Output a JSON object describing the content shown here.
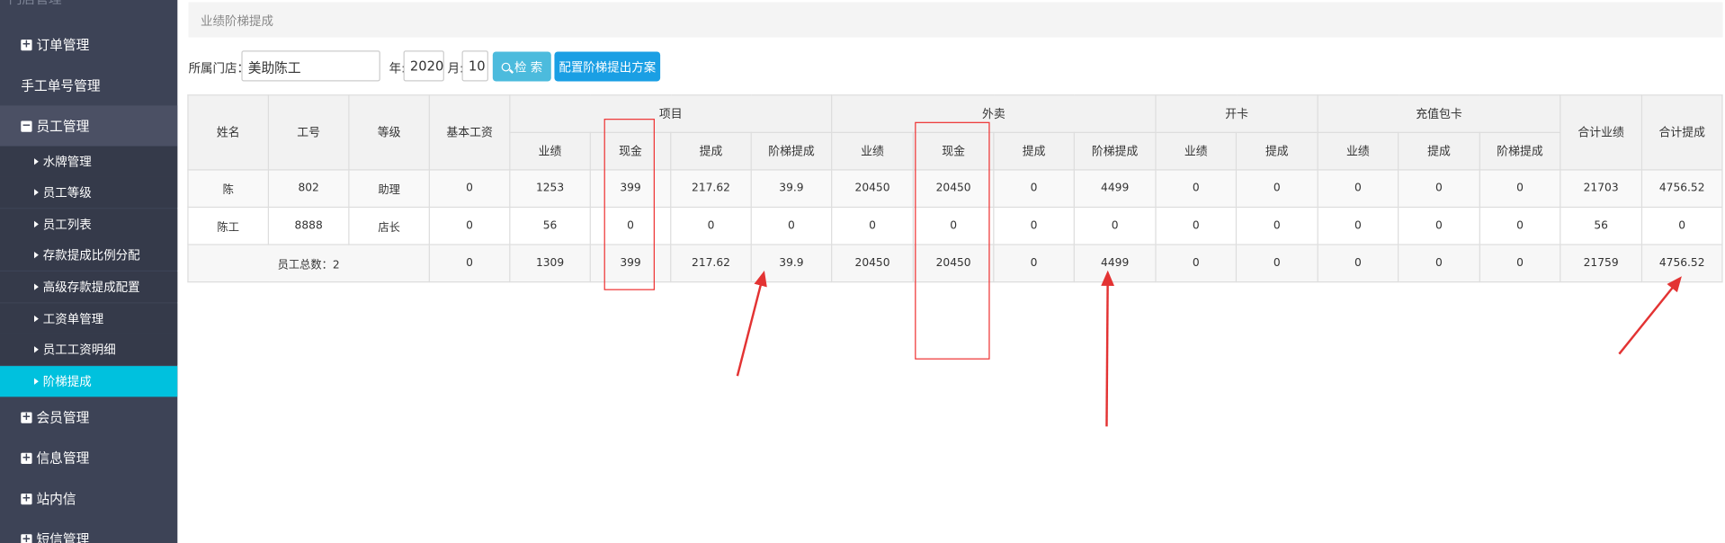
{
  "sidebar": {
    "top_label": "门店管理",
    "groups": [
      {
        "icon": "plus",
        "label": "订单管理"
      },
      {
        "label": "手工单号管理"
      },
      {
        "icon": "minus",
        "label": "员工管理"
      },
      {
        "icon": "plus",
        "label": "会员管理"
      },
      {
        "icon": "plus",
        "label": "信息管理"
      },
      {
        "icon": "plus",
        "label": "站内信"
      },
      {
        "icon": "plus",
        "label": "短信管理"
      }
    ],
    "sub_items": [
      "水牌管理",
      "员工等级",
      "员工列表",
      "存款提成比例分配",
      "高级存款提成配置",
      "工资单管理",
      "员工工资明细",
      "阶梯提成"
    ]
  },
  "breadcrumb": "业绩阶梯提成",
  "filter": {
    "store_label": "所属门店：",
    "store_value": "美助陈工",
    "year_label": "年:",
    "year_value": "2020",
    "month_label": "月:",
    "month_value": "10",
    "search_label": "检 索",
    "config_label": "配置阶梯提出方案"
  },
  "table": {
    "top_headers": {
      "name": "姓名",
      "id": "工号",
      "level": "等级",
      "base": "基本工资",
      "project": "项目",
      "takeout": "外卖",
      "card": "开卡",
      "recharge": "充值包卡",
      "total_perf": "合计业绩",
      "total_comm": "合计提成"
    },
    "sub_headers": [
      "业绩",
      "现金",
      "提成",
      "阶梯提成",
      "业绩",
      "现金",
      "提成",
      "阶梯提成",
      "业绩",
      "提成",
      "业绩",
      "提成",
      "阶梯提成"
    ],
    "rows": [
      {
        "name": "陈",
        "id": "802",
        "level": "助理",
        "base": "0",
        "cells": [
          "1253",
          "399",
          "217.62",
          "39.9",
          "20450",
          "20450",
          "0",
          "4499",
          "0",
          "0",
          "0",
          "0",
          "0"
        ],
        "total_perf": "21703",
        "total_comm": "4756.52"
      },
      {
        "name": "陈工",
        "id": "8888",
        "level": "店长",
        "base": "0",
        "cells": [
          "56",
          "0",
          "0",
          "0",
          "0",
          "0",
          "0",
          "0",
          "0",
          "0",
          "0",
          "0",
          "0"
        ],
        "total_perf": "56",
        "total_comm": "0"
      }
    ],
    "total": {
      "label": "员工总数：2",
      "base": "0",
      "cells": [
        "1309",
        "399",
        "217.62",
        "39.9",
        "20450",
        "20450",
        "0",
        "4499",
        "0",
        "0",
        "0",
        "0",
        "0"
      ],
      "total_perf": "21759",
      "total_comm": "4756.52"
    }
  },
  "colors": {
    "sidebar_bg": "#3d4356",
    "active_item": "#00c1de",
    "annotation": "#e33333"
  }
}
